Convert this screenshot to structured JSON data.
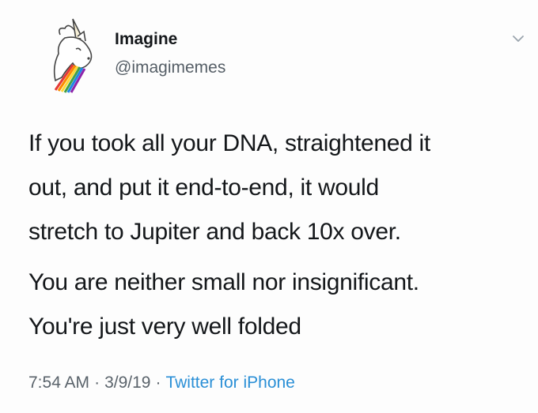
{
  "tweet": {
    "author": {
      "display_name": "Imagine",
      "handle": "@imagimemes",
      "avatar_icon": "unicorn-rainbow-icon"
    },
    "menu_icon": "chevron-down-icon",
    "paragraphs": [
      "If you took all your DNA, straightened it\nout, and put it end-to-end, it would\nstretch to Jupiter and back 10x over.",
      "You are neither small nor insignificant.\nYou're just very well folded"
    ],
    "meta": {
      "time": "7:54 AM",
      "separator": "·",
      "date": "3/9/19",
      "source": "Twitter for iPhone"
    }
  },
  "colors": {
    "text": "#14171a",
    "secondary": "#5a636b",
    "link": "#2a8fd6"
  }
}
